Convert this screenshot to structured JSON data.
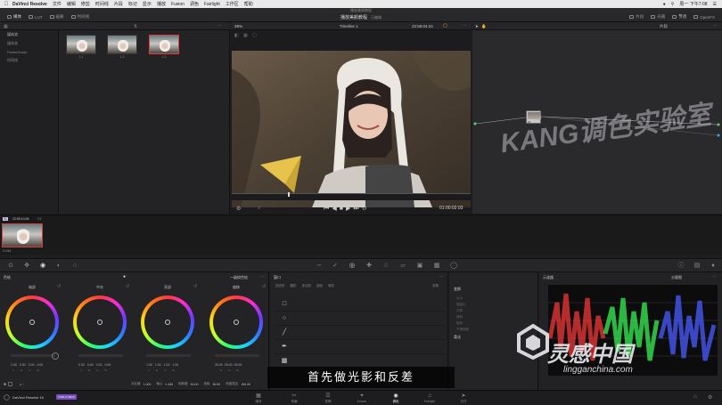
{
  "menubar": {
    "app_name": "DaVinci Resolve",
    "items": [
      "文件",
      "编辑",
      "修剪",
      "时间线",
      "片段",
      "标记",
      "显示",
      "播放",
      "Fusion",
      "调色",
      "Fairlight",
      "工作区",
      "帮助"
    ],
    "clock": "周一 下午7:08"
  },
  "project": {
    "title": "播放美颜教程"
  },
  "toolbar": {
    "media_label": "媒体",
    "lut_label": "LUT",
    "stills_label": "画廊",
    "timeline_label": "时间线",
    "project_title": "播放美颜教程",
    "project_status": "已编辑",
    "clips_label": "片段",
    "lightbox_label": "光箱",
    "nodes_label": "节点",
    "opencl_label": "OpenFX"
  },
  "media_pool": {
    "tree": [
      "媒体池",
      "媒体池",
      "PowerGrade",
      "时间线"
    ],
    "thumbs": [
      {
        "label": "1.1"
      },
      {
        "label": "1.2"
      },
      {
        "label": "1.3"
      }
    ]
  },
  "viewer": {
    "zoom": "39%",
    "timeline_name": "Timeline 1",
    "timecode_top": "22:59:04:24",
    "timecode": "01:00:02:03"
  },
  "nodes": {
    "mode": "片段",
    "node_label": "01"
  },
  "clipstrip": {
    "number": "01",
    "timecode": "22:59:10:06",
    "track": "V1",
    "codec": "H.264"
  },
  "wheels": {
    "panel_title": "色轮",
    "mode": "一级校色轮",
    "items": [
      {
        "title": "暗部",
        "values": [
          "0.00",
          "0.00",
          "0.00",
          "0.00"
        ]
      },
      {
        "title": "中灰",
        "values": [
          "0.00",
          "0.00",
          "0.00",
          "0.00"
        ]
      },
      {
        "title": "亮部",
        "values": [
          "1.00",
          "1.00",
          "1.00",
          "1.00"
        ]
      },
      {
        "title": "偏移",
        "values": [
          "25.00",
          "25.00",
          "25.00",
          "25.00"
        ]
      }
    ],
    "channel_letters": [
      "Y",
      "R",
      "G",
      "B"
    ],
    "bottom": {
      "contrast_label": "对比度",
      "contrast": "1.000",
      "pivot_label": "轴心",
      "pivot": "0.435",
      "sat_label": "饱和度",
      "sat": "50.00",
      "hue_label": "色相",
      "hue": "50.00",
      "lum_label": "亮度混合",
      "lum": "100.00"
    }
  },
  "window_panel": {
    "title": "窗口",
    "tabs": [
      "四边形",
      "圆形",
      "多边形",
      "曲线",
      "渐变"
    ],
    "right_label": "变换"
  },
  "props": {
    "title": "变换",
    "rows": [
      "大小",
      "宽高比",
      "平移",
      "倾斜",
      "旋转",
      "不透明度"
    ],
    "soft_title": "柔化"
  },
  "scopes": {
    "title": "示波器",
    "mode": "分量图"
  },
  "pagebar": {
    "app": "DaVinci Resolve 16",
    "badge": "PUBLIC BETA",
    "pages": [
      "媒体",
      "快编",
      "剪辑",
      "Fusion",
      "调色",
      "Fairlight",
      "交付"
    ],
    "active": "调色"
  },
  "subtitle": "首先做光影和反差",
  "watermarks": {
    "kang": "KANG调色实验室",
    "brand": "灵感中国",
    "url": "lingganchina.com"
  }
}
